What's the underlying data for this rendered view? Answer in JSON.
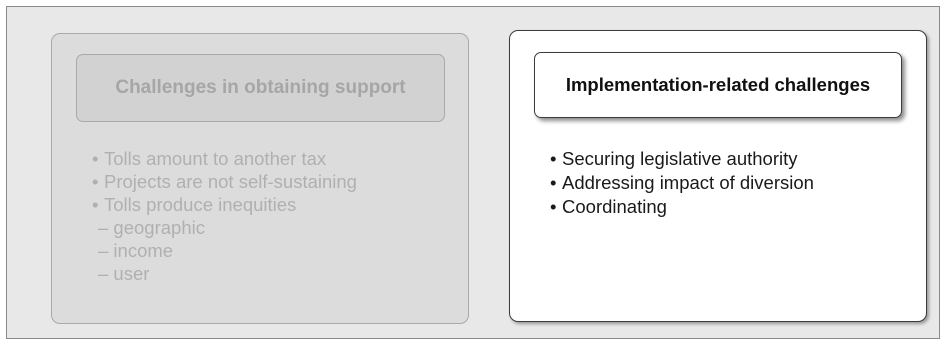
{
  "left_panel": {
    "title": "Challenges in obtaining support",
    "items": [
      "Tolls amount to another tax",
      "Projects are not self-sustaining",
      "Tolls produce inequities"
    ],
    "sub_items": [
      "– geographic",
      "– income",
      "– user"
    ]
  },
  "right_panel": {
    "title": "Implementation-related challenges",
    "items": [
      "Securing legislative authority",
      "Addressing impact of diversion",
      "Coordinating"
    ]
  },
  "bullet": "•"
}
